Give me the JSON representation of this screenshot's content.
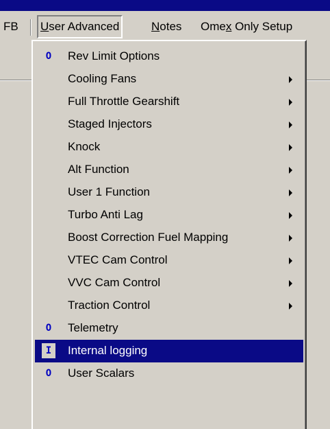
{
  "menubar": {
    "items": [
      {
        "label": "FB"
      },
      {
        "label": "User Advanced"
      },
      {
        "label": "Notes"
      },
      {
        "label": "Omex Only Setup"
      }
    ]
  },
  "menu": {
    "items": [
      {
        "label": "Rev Limit Options",
        "mark": "O",
        "submenu": false
      },
      {
        "label": "Cooling Fans",
        "mark": "",
        "submenu": true
      },
      {
        "label": "Full Throttle Gearshift",
        "mark": "",
        "submenu": true
      },
      {
        "label": "Staged Injectors",
        "mark": "",
        "submenu": true
      },
      {
        "label": "Knock",
        "mark": "",
        "submenu": true
      },
      {
        "label": "Alt Function",
        "mark": "",
        "submenu": true
      },
      {
        "label": "User 1 Function",
        "mark": "",
        "submenu": true
      },
      {
        "label": "Turbo Anti Lag",
        "mark": "",
        "submenu": true
      },
      {
        "label": "Boost Correction Fuel Mapping",
        "mark": "",
        "submenu": true
      },
      {
        "label": "VTEC Cam Control",
        "mark": "",
        "submenu": true
      },
      {
        "label": "VVC Cam Control",
        "mark": "",
        "submenu": true
      },
      {
        "label": "Traction Control",
        "mark": "",
        "submenu": true
      },
      {
        "label": "Telemetry",
        "mark": "O",
        "submenu": false
      },
      {
        "label": "Internal logging",
        "mark": "I",
        "submenu": false,
        "selected": true
      },
      {
        "label": "User Scalars",
        "mark": "O",
        "submenu": false
      }
    ]
  },
  "colors": {
    "title_blue": "#0a0a86",
    "highlight": "#0a0a86",
    "face": "#d4d0c8",
    "mark_blue": "#0000c0"
  }
}
